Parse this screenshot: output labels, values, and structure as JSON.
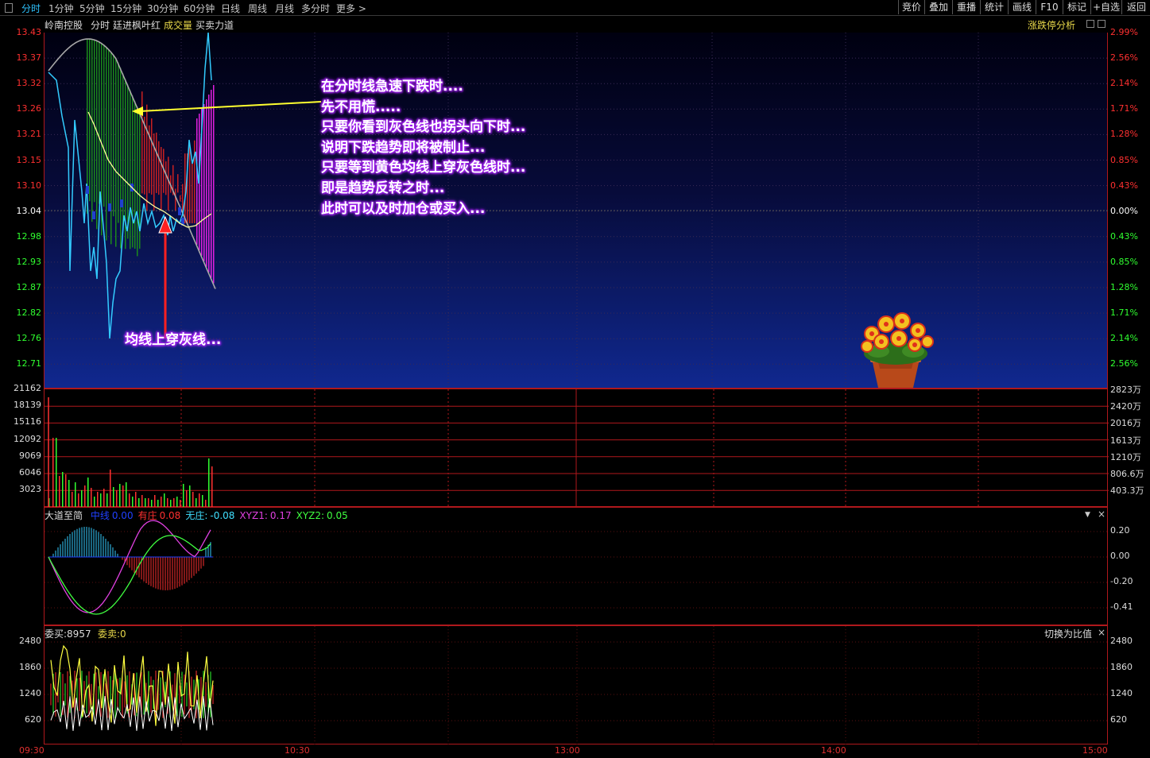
{
  "toolbar": {
    "timeframes": [
      "分时",
      "1分钟",
      "5分钟",
      "15分钟",
      "30分钟",
      "60分钟",
      "日线",
      "周线",
      "月线",
      "多分时",
      "更多"
    ],
    "right_buttons": [
      "竞价",
      "叠加",
      "重播",
      "统计",
      "画线",
      "F10",
      "标记",
      "+自选",
      "返回"
    ]
  },
  "header": {
    "stock_name": "岭南控股",
    "mode": "分时",
    "tags": [
      "廷进枫叶红",
      "成交量",
      "买卖力道"
    ],
    "right_link": "涨跌停分析"
  },
  "main_chart": {
    "price_labels": [
      "13.43",
      "13.37",
      "13.32",
      "13.26",
      "13.21",
      "13.15",
      "13.10",
      "13.04",
      "12.98",
      "12.93",
      "12.87",
      "12.82",
      "12.76",
      "12.71"
    ],
    "pct_labels": [
      "2.99%",
      "2.56%",
      "2.14%",
      "1.71%",
      "1.28%",
      "0.85%",
      "0.43%",
      "0.00%",
      "0.43%",
      "0.85%",
      "1.28%",
      "1.71%",
      "2.14%",
      "2.56%"
    ],
    "colors": {
      "up": "#ff3030",
      "down": "#30ff30",
      "neutral": "#ffffff",
      "price_line": "#33ccff",
      "avg_line": "#ffff99",
      "grey_line": "#a8a8a8",
      "hist_green": "#1b8a1b",
      "hist_red": "#c82020",
      "hist_magenta": "#e020e0"
    },
    "annotations": {
      "right_block": [
        "在分时线急速下跌时....",
        "先不用慌.....",
        "只要你看到灰色线也拐头向下时...",
        "说明下跌趋势即将被制止...",
        "只要等到黄色均线上穿灰色线时...",
        "即是趋势反转之时...",
        "此时可以及时加仓或买入..."
      ],
      "bottom_note": "均线上穿灰线..."
    },
    "decoration": "flower-pot-icon"
  },
  "volume_chart": {
    "left_labels": [
      "21162",
      "18139",
      "15116",
      "12092",
      "9069",
      "6046",
      "3023"
    ],
    "right_labels": [
      "2823万",
      "2420万",
      "2016万",
      "1613万",
      "1210万",
      "806.6万",
      "403.3万"
    ]
  },
  "indicator": {
    "name": "大道至简",
    "items": [
      {
        "label": "中线",
        "value": "0.00",
        "color": "#2040ff"
      },
      {
        "label": "有庄",
        "value": "0.08",
        "color": "#ff3030"
      },
      {
        "label": "无庄:",
        "value": "-0.08",
        "color": "#40e0ff"
      },
      {
        "label": "XYZ1:",
        "value": "0.17",
        "color": "#e040e0"
      },
      {
        "label": "XYZ2:",
        "value": "0.05",
        "color": "#40ff40"
      }
    ],
    "right_labels": [
      "0.20",
      "0.00",
      "-0.20",
      "-0.41"
    ]
  },
  "bid_ask": {
    "buy_label": "委买:8957",
    "sell_label": "委卖:0",
    "switch_label": "切换为比值",
    "labels": [
      "2480",
      "1860",
      "1240",
      "620"
    ]
  },
  "time_axis": [
    "09:30",
    "10:30",
    "13:00",
    "14:00",
    "15:00"
  ]
}
